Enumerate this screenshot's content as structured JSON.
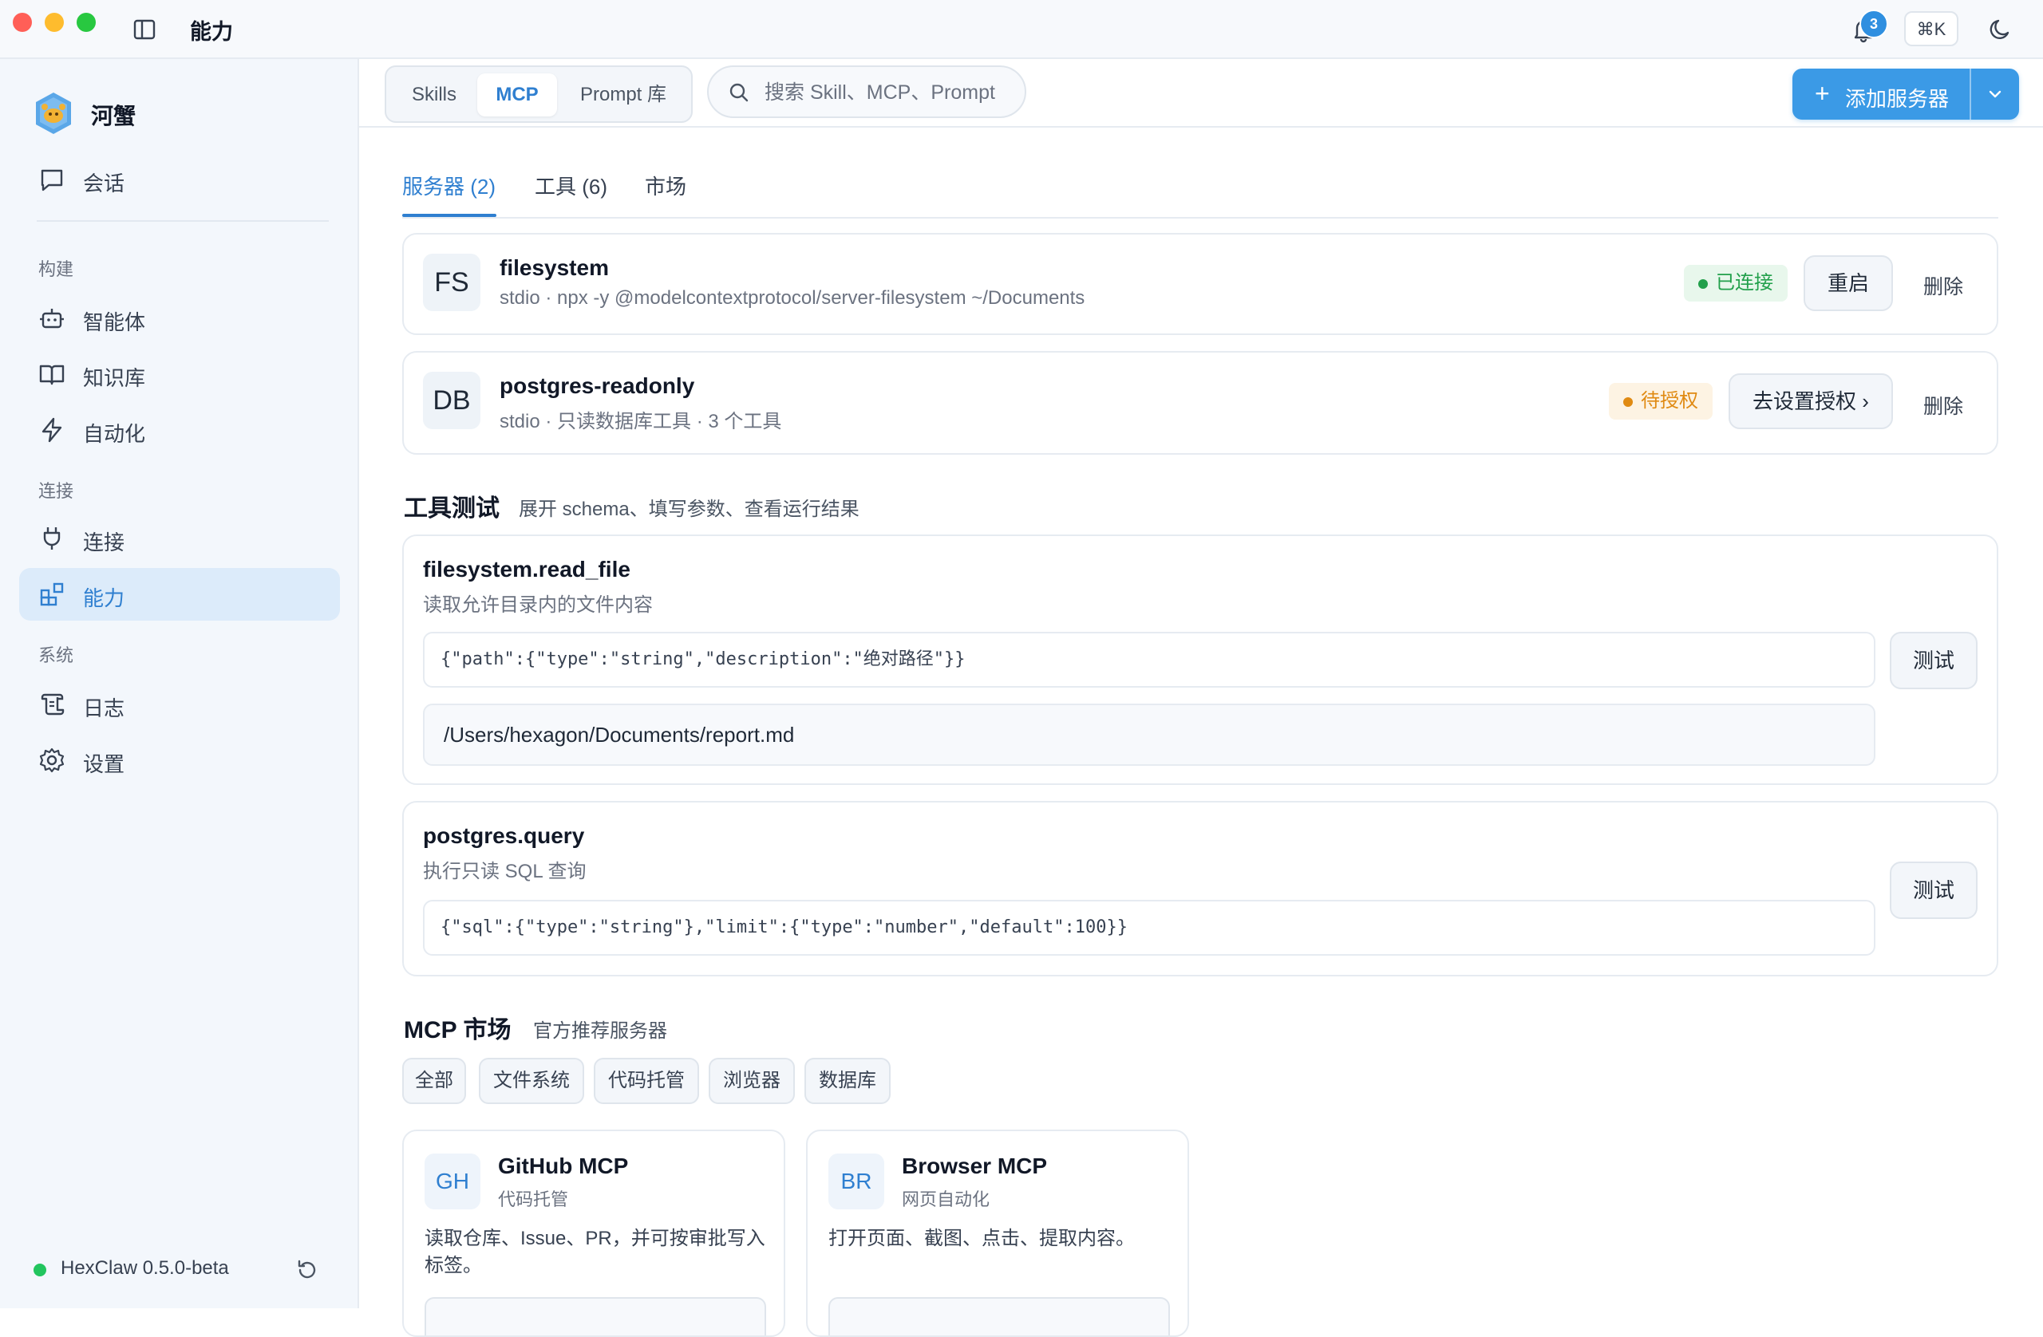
{
  "app": {
    "title": "能力",
    "notification_count": "3",
    "shortcut": "⌘K"
  },
  "sidebar": {
    "brand": "河蟹",
    "chat_label": "会话",
    "sections": {
      "build": "构建",
      "connect": "连接",
      "system": "系统"
    },
    "items": {
      "agents": "智能体",
      "knowledge": "知识库",
      "automation": "自动化",
      "connections": "连接",
      "capabilities": "能力",
      "logs": "日志",
      "settings": "设置"
    },
    "active_item": "capabilities",
    "version": "HexClaw 0.5.0-beta"
  },
  "header": {
    "segments": [
      "Skills",
      "MCP",
      "Prompt 库"
    ],
    "active_segment": "MCP",
    "search_placeholder": "搜索 Skill、MCP、Prompt",
    "add_button_label": "添加服务器"
  },
  "tabs": {
    "servers": "服务器 (2)",
    "tools": "工具 (6)",
    "market": "市场",
    "active": "servers"
  },
  "servers": [
    {
      "avatar": "FS",
      "name": "filesystem",
      "desc": "stdio · npx -y @modelcontextprotocol/server-filesystem ~/Documents",
      "status": "已连接",
      "status_color": "#22a04b",
      "action": "重启",
      "delete": "删除"
    },
    {
      "avatar": "DB",
      "name": "postgres-readonly",
      "desc": "stdio · 只读数据库工具 · 3 个工具",
      "status": "待授权",
      "status_color": "#e08a12",
      "action": "去设置授权 ›",
      "delete": "删除"
    }
  ],
  "tool_test": {
    "title": "工具测试",
    "subtitle": "展开 schema、填写参数、查看运行结果",
    "tools": [
      {
        "name": "filesystem.read_file",
        "desc": "读取允许目录内的文件内容",
        "schema": "{\"path\":{\"type\":\"string\",\"description\":\"绝对路径\"}}",
        "param_value": "/Users/hexagon/Documents/report.md",
        "test_label": "测试"
      },
      {
        "name": "postgres.query",
        "desc": "执行只读 SQL 查询",
        "schema": "{\"sql\":{\"type\":\"string\"},\"limit\":{\"type\":\"number\",\"default\":100}}",
        "test_label": "测试"
      }
    ]
  },
  "market": {
    "title": "MCP 市场",
    "subtitle": "官方推荐服务器",
    "filters": [
      "全部",
      "文件系统",
      "代码托管",
      "浏览器",
      "数据库"
    ],
    "cards": [
      {
        "avatar": "GH",
        "name": "GitHub MCP",
        "category": "代码托管",
        "desc": "读取仓库、Issue、PR，并可按审批写入标签。"
      },
      {
        "avatar": "BR",
        "name": "Browser MCP",
        "category": "网页自动化",
        "desc": "打开页面、截图、点击、提取内容。"
      }
    ]
  },
  "colors": {
    "accent": "#2f7fd0",
    "primary_button": "#3b9ae6",
    "connected": "#22a04b",
    "pending": "#e08a12"
  }
}
